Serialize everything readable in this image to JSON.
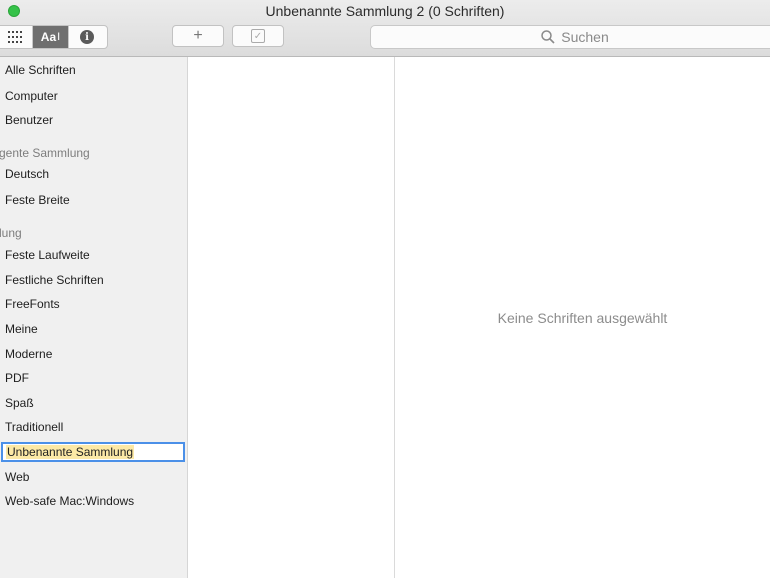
{
  "window": {
    "title": "Unbenannte Sammlung 2 (0 Schriften)"
  },
  "toolbar": {
    "view_buttons": [
      {
        "label": "",
        "icon": "grid-icon"
      },
      {
        "label": "Aa",
        "icon": "sample-text-icon"
      },
      {
        "label": "i",
        "icon": "info-icon"
      }
    ],
    "add_label": "+",
    "check_label": "✓",
    "search_placeholder": "Suchen"
  },
  "sidebar": {
    "top": [
      {
        "label": "Alle Schriften"
      },
      {
        "label": "Computer"
      },
      {
        "label": "Benutzer"
      }
    ],
    "smart_header": "gente Sammlung",
    "smart": [
      {
        "label": "Deutsch"
      },
      {
        "label": "Feste Breite"
      }
    ],
    "collections_header": "lung",
    "collections": [
      {
        "label": "Feste Laufweite"
      },
      {
        "label": "Festliche Schriften"
      },
      {
        "label": "FreeFonts"
      },
      {
        "label": "Meine"
      },
      {
        "label": "Moderne"
      },
      {
        "label": "PDF"
      },
      {
        "label": "Spaß"
      },
      {
        "label": "Traditionell"
      }
    ],
    "editing_value": "Unbenannte Sammlung",
    "after_edit": [
      {
        "label": "Web"
      },
      {
        "label": "Web-safe Mac:Windows"
      }
    ]
  },
  "preview": {
    "empty_message": "Keine Schriften ausgewählt"
  },
  "colors": {
    "selection_border": "#4b90e8",
    "text_selection": "#fce9a6",
    "traffic_green": "#35c249"
  }
}
